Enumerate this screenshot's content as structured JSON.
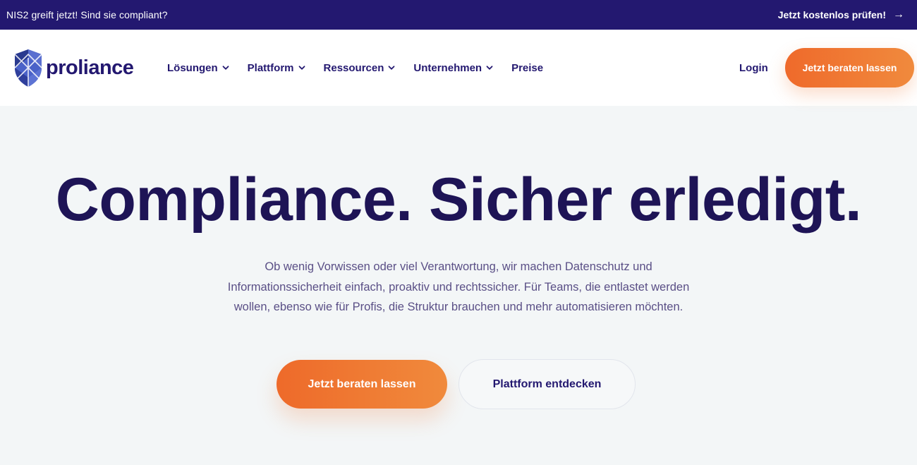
{
  "announcement": {
    "text": "NIS2 greift jetzt! Sind sie compliant?",
    "link_label": "Jetzt kostenlos prüfen!",
    "link_icon": "arrow-right-icon"
  },
  "header": {
    "logo_text": "proliance",
    "logo_icon": "shield-logo-icon",
    "nav": [
      {
        "label": "Lösungen",
        "has_dropdown": true
      },
      {
        "label": "Plattform",
        "has_dropdown": true
      },
      {
        "label": "Ressourcen",
        "has_dropdown": true
      },
      {
        "label": "Unternehmen",
        "has_dropdown": true
      },
      {
        "label": "Preise",
        "has_dropdown": false
      }
    ],
    "login_label": "Login",
    "cta_label": "Jetzt beraten lassen"
  },
  "hero": {
    "title": "Compliance. Sicher erledigt.",
    "subtitle_lines": [
      "Ob wenig Vorwissen oder viel Verantwortung, wir machen Datenschutz und",
      "Informationssicherheit einfach, proaktiv und rechtssicher. Für Teams, die entlastet werden",
      "wollen, ebenso wie für Profis, die Struktur brauchen und mehr automatisieren möchten."
    ],
    "primary_button": "Jetzt beraten lassen",
    "secondary_button": "Plattform entdecken"
  },
  "colors": {
    "brand_dark": "#231870",
    "accent_orange": "#ef6a2b",
    "background": "#f3f6f7"
  }
}
